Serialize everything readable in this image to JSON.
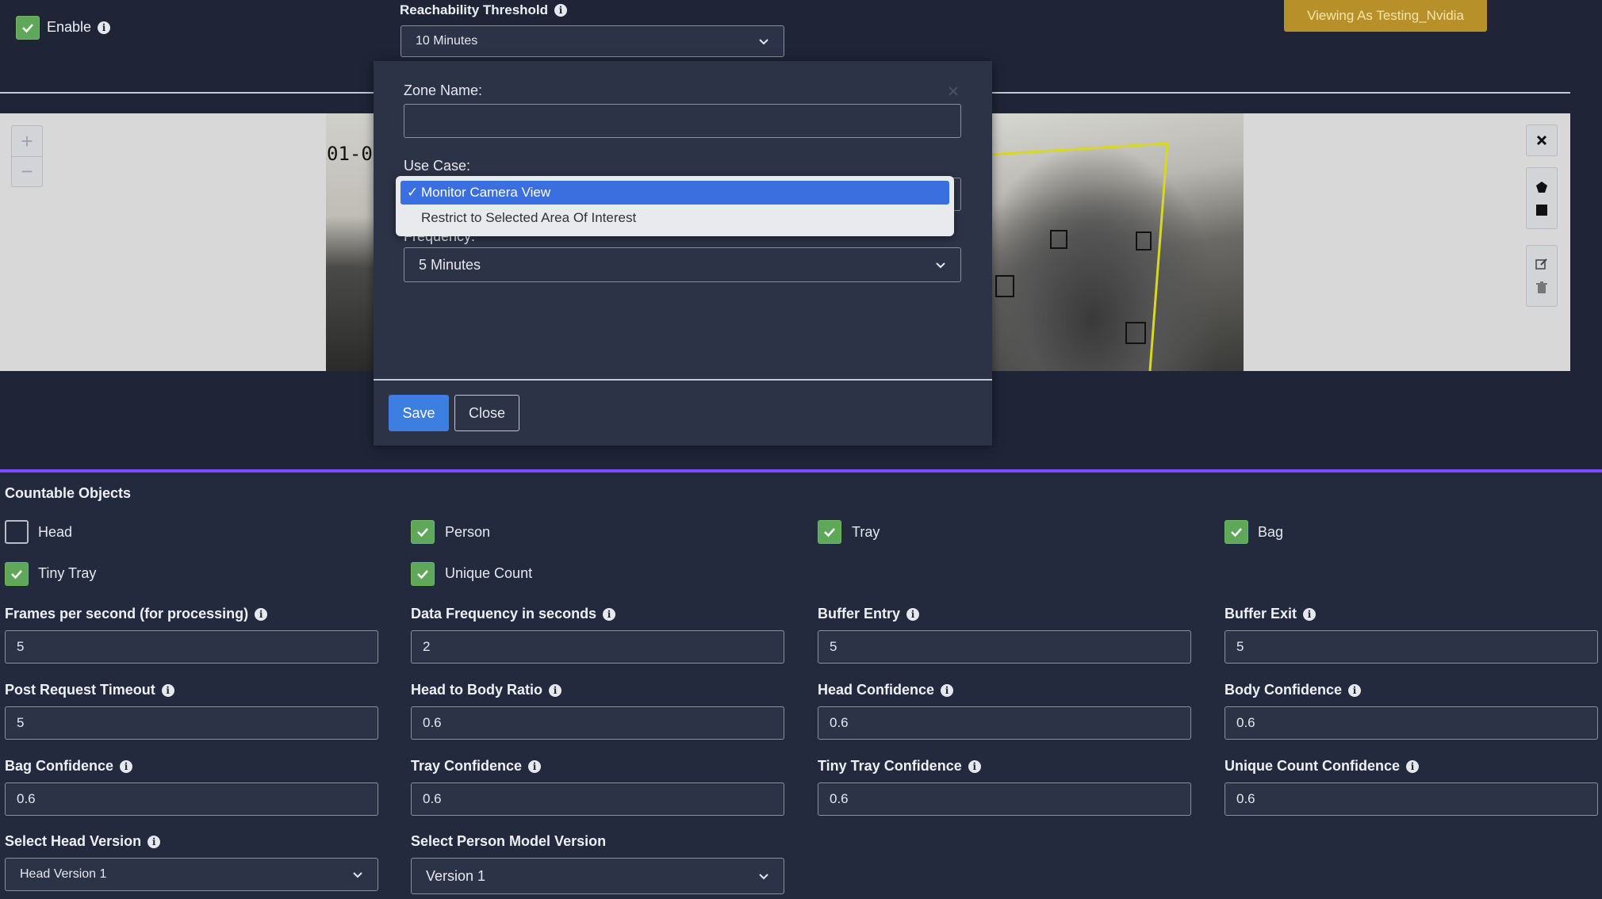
{
  "top": {
    "enable_label": "Enable",
    "enable_checked": true,
    "reachability_label": "Reachability Threshold",
    "reachability_value": "10 Minutes",
    "viewing_as": "Viewing As Testing_Nvidia"
  },
  "camera": {
    "timestamp_fragment": "01-0",
    "zoom_in": "+",
    "zoom_out": "−"
  },
  "modal": {
    "zone_name_label": "Zone Name:",
    "zone_name_value": "",
    "use_case_label": "Use Case:",
    "use_case_options": [
      "Monitor Camera View",
      "Restrict to Selected Area Of Interest"
    ],
    "use_case_selected_check": "✓",
    "frequency_label": "Frequency:",
    "frequency_value": "5 Minutes",
    "save_label": "Save",
    "close_label": "Close"
  },
  "countable": {
    "title": "Countable Objects",
    "items": [
      {
        "label": "Head",
        "checked": false
      },
      {
        "label": "Person",
        "checked": true
      },
      {
        "label": "Tray",
        "checked": true
      },
      {
        "label": "Bag",
        "checked": true
      },
      {
        "label": "Tiny Tray",
        "checked": true
      },
      {
        "label": "Unique Count",
        "checked": true
      }
    ]
  },
  "fields": [
    {
      "label": "Frames per second (for processing)",
      "value": "5"
    },
    {
      "label": "Data Frequency in seconds",
      "value": "2"
    },
    {
      "label": "Buffer Entry",
      "value": "5"
    },
    {
      "label": "Buffer Exit",
      "value": "5"
    },
    {
      "label": "Post Request Timeout",
      "value": "5"
    },
    {
      "label": "Head to Body Ratio",
      "value": "0.6"
    },
    {
      "label": "Head Confidence",
      "value": "0.6"
    },
    {
      "label": "Body Confidence",
      "value": "0.6"
    },
    {
      "label": "Bag Confidence",
      "value": "0.6"
    },
    {
      "label": "Tray Confidence",
      "value": "0.6"
    },
    {
      "label": "Tiny Tray Confidence",
      "value": "0.6"
    },
    {
      "label": "Unique Count Confidence",
      "value": "0.6"
    }
  ],
  "versions": {
    "head_label": "Select Head Version",
    "head_value": "Head Version 1",
    "person_label": "Select Person Model Version",
    "person_value": "Version 1"
  },
  "colors": {
    "accent_purple": "#7c4dff",
    "save_blue": "#3d7fe0",
    "checkbox_green": "#5fa85a",
    "viewing_gold": "#b8902a"
  }
}
